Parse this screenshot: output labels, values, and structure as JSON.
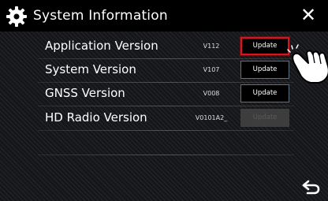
{
  "header": {
    "title": "System Information",
    "close_label": "✕",
    "settings_icon": "gear-icon"
  },
  "rows": [
    {
      "label": "Application Version",
      "version": "V112",
      "button": "Update",
      "state": "highlighted"
    },
    {
      "label": "System Version",
      "version": "V107",
      "button": "Update",
      "state": "enabled"
    },
    {
      "label": "GNSS Version",
      "version": "V008",
      "button": "Update",
      "state": "enabled"
    },
    {
      "label": "HD Radio Version",
      "version": "V0101A2_",
      "button": "Update",
      "state": "disabled"
    }
  ],
  "footer": {
    "back_icon": "return-arrow-icon"
  },
  "overlay": {
    "pointer_icon": "hand-pointer-icon"
  },
  "colors": {
    "highlight": "#d3161f",
    "button_border": "#5e7080",
    "header_bg": "#000000"
  }
}
